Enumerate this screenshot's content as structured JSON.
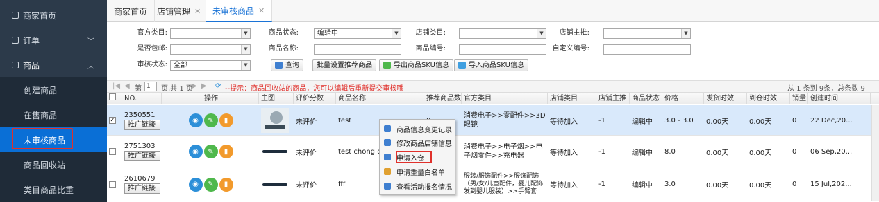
{
  "sidebar": {
    "items": [
      {
        "label": "商家首页",
        "icon": "monitor-icon"
      },
      {
        "label": "订单",
        "icon": "order-icon"
      },
      {
        "label": "商品",
        "icon": "goods-icon"
      },
      {
        "label": "创建商品"
      },
      {
        "label": "在售商品"
      },
      {
        "label": "未审核商品"
      },
      {
        "label": "商品回收站"
      },
      {
        "label": "类目商品比重"
      }
    ]
  },
  "tabs": [
    {
      "label": "商家首页"
    },
    {
      "label": "店铺管理"
    },
    {
      "label": "未审核商品"
    }
  ],
  "filters": {
    "official_category_label": "官方类目:",
    "official_category_value": "",
    "goods_status_label": "商品状态:",
    "goods_status_value": "编辑中",
    "shop_category_label": "店铺类目:",
    "shop_category_value": "",
    "shop_recommend_label": "店铺主推:",
    "shop_recommend_value": "",
    "free_shipping_label": "是否包邮:",
    "free_shipping_value": "",
    "goods_name_label": "商品名称:",
    "goods_name_value": "",
    "goods_no_label": "商品编号:",
    "goods_no_value": "",
    "custom_no_label": "自定义编号:",
    "custom_no_value": "",
    "review_status_label": "审核状态:",
    "review_status_value": "全部",
    "query_btn": "查询",
    "batch_recommend_btn": "批量设置推荐商品",
    "export_btn": "导出商品SKU信息",
    "import_btn": "导入商品SKU信息"
  },
  "pager": {
    "page_label": "第",
    "page_value": "1",
    "page_total": "页,共 1 页",
    "tip": "--提示：商品回收站的商品，您可以编辑后重新提交审核哦",
    "summary": "从 1 条到 9条，总条数 9"
  },
  "table": {
    "headers": [
      "NO.",
      "操作",
      "主图",
      "评价分数",
      "商品名称",
      "推荐商品数",
      "官方类目",
      "店铺类目",
      "店铺主推",
      "商品状态",
      "价格",
      "发货时效",
      "到仓时效",
      "销量",
      "创建时间"
    ],
    "promo_label": "推广链接",
    "rows": [
      {
        "no": "2350551",
        "score": "未评价",
        "name": "test",
        "recommend": "0",
        "category": "消费电子>>零配件>>3D眼镜",
        "shop_category": "等待加入",
        "shop_recommend": "-1",
        "status": "编辑中",
        "price": "3.0 - 3.0",
        "ship": "0.00天",
        "arrive": "0.00天",
        "sales": "0",
        "created": "22 Dec,20...",
        "checked": true
      },
      {
        "no": "2751303",
        "score": "未评价",
        "name": "test chong dian",
        "recommend": "",
        "category": "消费电子>>电子烟>>电子烟零件>>充电器",
        "shop_category": "等待加入",
        "shop_recommend": "-1",
        "status": "编辑中",
        "price": "8.0",
        "ship": "0.00天",
        "arrive": "0.00天",
        "sales": "0",
        "created": "06 Sep,20...",
        "checked": false
      },
      {
        "no": "2610679",
        "score": "未评价",
        "name": "fff",
        "recommend": "",
        "category": "服装/服饰配件>>服饰配饰（男/女/儿童配件，婴儿配饰发到婴儿服装）>>手臂套",
        "shop_category": "等待加入",
        "shop_recommend": "-1",
        "status": "编辑中",
        "price": "3.0",
        "ship": "0.00天",
        "arrive": "0.00天",
        "sales": "0",
        "created": "15 Jul,202...",
        "checked": false
      }
    ]
  },
  "context_menu": {
    "items": [
      {
        "label": "商品信息变更记录",
        "color": "#3f7fd0"
      },
      {
        "label": "修改商品店铺信息",
        "color": "#3f7fd0"
      },
      {
        "label": "申请入仓",
        "color": "#3f7fd0"
      },
      {
        "label": "申请重量白名单",
        "color": "#e0a030"
      },
      {
        "label": "查看活动报名情况",
        "color": "#3f7fd0"
      }
    ]
  },
  "colors": {
    "sidebar_bg": "#2c3a4a",
    "active_blue": "#0a6fd6",
    "highlight_red": "#e0312c",
    "view_icon": "#2c8fd8",
    "edit_icon": "#4fb84c",
    "delete_icon": "#f29a2c"
  }
}
